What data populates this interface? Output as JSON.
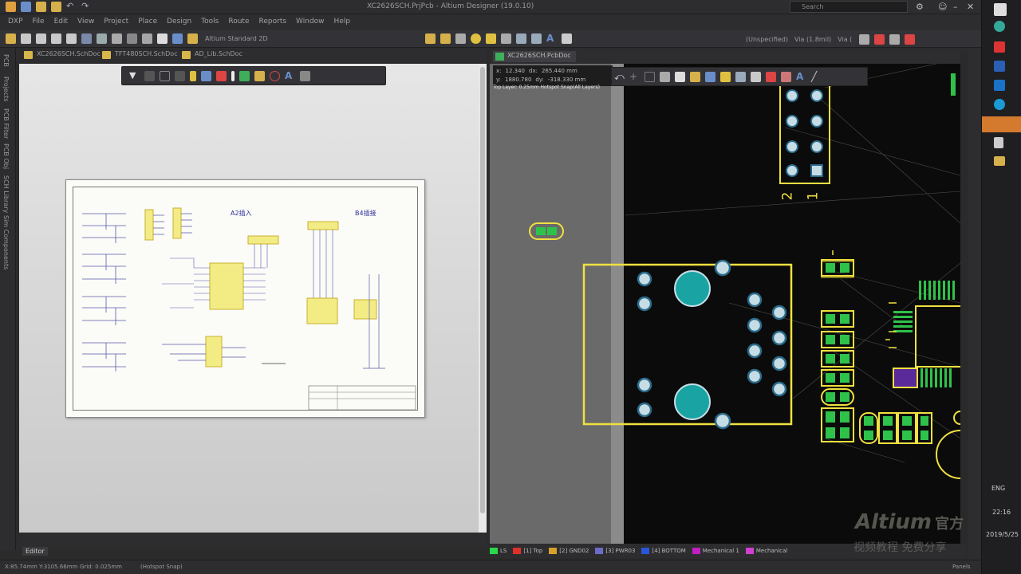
{
  "window": {
    "title": "XC2626SCH.PrjPcb - Altium Designer (19.0.10)",
    "search_placeholder": "Search"
  },
  "menu": {
    "items": [
      "DXP",
      "File",
      "Edit",
      "View",
      "Project",
      "Place",
      "Design",
      "Tools",
      "Route",
      "Reports",
      "Window",
      "Help"
    ]
  },
  "toolbar": {
    "doc_selector": "Altium Standard 2D",
    "net_filter": "(Unspecified)",
    "via_style": "Via (1.8mil)",
    "rule": "Via ("
  },
  "doc_tabs": [
    "XC2626SCH.SchDoc",
    "TFT480SCH.SchDoc",
    "AD_Lib.SchDoc"
  ],
  "left_tabs": [
    "PCB",
    "Projects",
    "PCB Filter",
    "PCB Obj",
    "SCH Library",
    "Sim Components"
  ],
  "schematic": {
    "label_a": "A2插入",
    "label_b": "B4插接",
    "editor_tab": "Editor"
  },
  "pcb": {
    "tab_label": "XC2626SCH.PcbDoc",
    "readout": {
      "x_label": "x:",
      "x_value": "12.340",
      "dx_label": "dx:",
      "dx_value": "265.440 mm",
      "y_label": "y:",
      "y_value": "1880.780",
      "dy_label": "dy:",
      "dy_value": "-318.330 mm",
      "snap_text": "Top Layer: 0.25mm  Hotspot Snap(All Layers)"
    },
    "header_labels": [
      "2",
      "1"
    ]
  },
  "layers": [
    {
      "name": "LS",
      "color": "#2bd94a"
    },
    {
      "name": "[1] Top",
      "color": "#e0302a"
    },
    {
      "name": "[2] GND02",
      "color": "#d8a02a"
    },
    {
      "name": "[3] PWR03",
      "color": "#6c6cc8"
    },
    {
      "name": "[4] BOTTOM",
      "color": "#2a55d8"
    },
    {
      "name": "Mechanical 1",
      "color": "#c020c0"
    },
    {
      "name": "Mechanical",
      "color": "#d040d0"
    }
  ],
  "status": {
    "coords": "X:85.74mm Y:3105.66mm",
    "grid": "Grid: 0.025mm",
    "snap": "(Hotspot Snap)",
    "panel": "Panels"
  },
  "taskbar": {
    "lang": "ENG",
    "time": "22:16",
    "date": "2019/5/25"
  },
  "watermark": {
    "brand": "Altium",
    "sub_1": "官方",
    "sub_2": "视频教程 免费分享"
  },
  "colors": {
    "pcb_bg": "#0b0b0b",
    "silkscreen": "#f0e040",
    "pad_top": "#2fc24a",
    "pad_mask": "#c6dde6",
    "mount_hole": "#1aa3a3"
  }
}
